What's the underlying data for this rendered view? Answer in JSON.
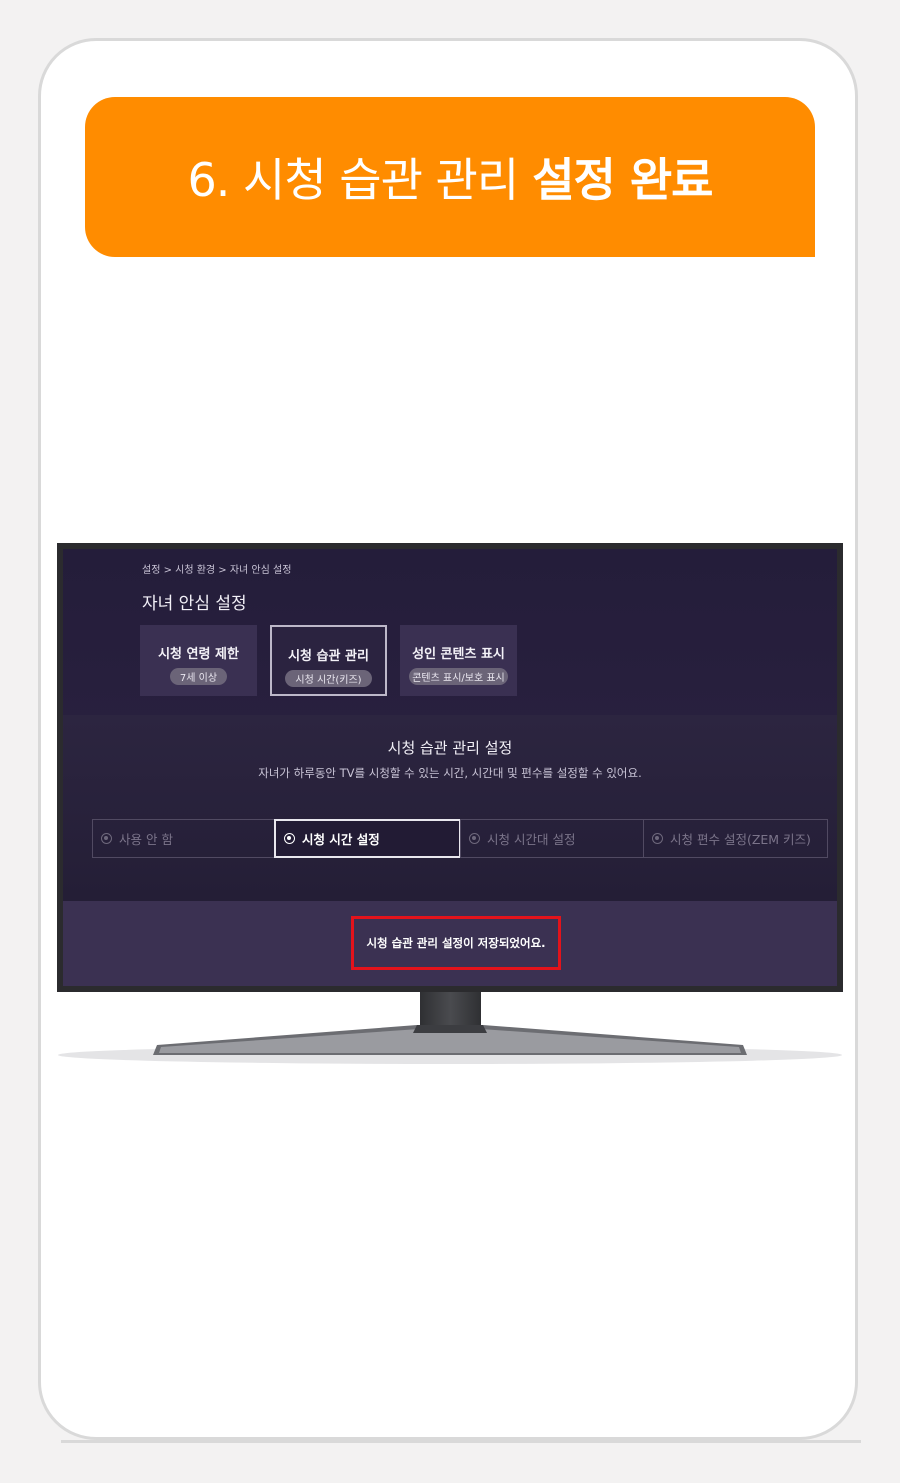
{
  "banner": {
    "title_light": "6. 시청 습관 관리",
    "title_bold": "설정 완료",
    "color": "#ff8c00"
  },
  "tv": {
    "breadcrumb": "설정 > 시청 환경 > 자녀 안심 설정",
    "title": "자녀 안심 설정",
    "categories": [
      {
        "name": "시청 연령 제한",
        "badge": "7세 이상"
      },
      {
        "name": "시청 습관 관리",
        "badge": "시청 시간(키즈)"
      },
      {
        "name": "성인 콘텐츠 표시",
        "badge": "콘텐츠 표시/보호 표시"
      }
    ],
    "panel": {
      "title": "시청 습관 관리 설정",
      "description": "자녀가 하루동안 TV를 시청할 수 있는 시간, 시간대 및 편수를 설정할 수 있어요."
    },
    "options": [
      {
        "label": "사용 안 함"
      },
      {
        "label": "시청 시간 설정"
      },
      {
        "label": "시청 시간대 설정"
      },
      {
        "label": "시청 편수 설정(ZEM 키즈)"
      }
    ],
    "toast": "시청 습관 관리 설정이 저장되었어요.",
    "highlight_color": "#e3131b"
  }
}
